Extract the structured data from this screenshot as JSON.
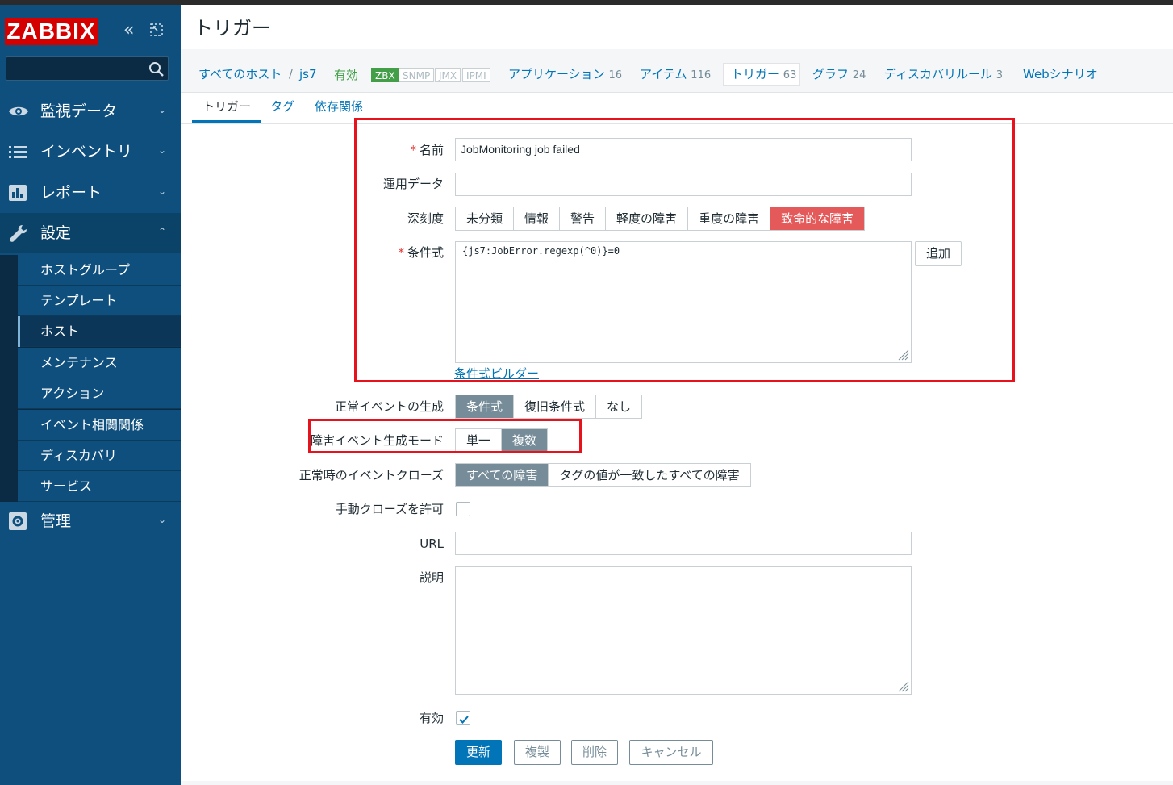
{
  "app": {
    "logo": "ZABBIX",
    "page_title": "トリガー"
  },
  "sidebar": {
    "search_placeholder": "",
    "items": [
      {
        "label": "監視データ",
        "icon": "eye-icon"
      },
      {
        "label": "インベントリ",
        "icon": "list-icon"
      },
      {
        "label": "レポート",
        "icon": "bar-chart-icon"
      },
      {
        "label": "設定",
        "icon": "wrench-icon"
      },
      {
        "label": "管理",
        "icon": "gear-icon"
      }
    ],
    "sub_items": [
      {
        "label": "ホストグループ"
      },
      {
        "label": "テンプレート"
      },
      {
        "label": "ホスト"
      },
      {
        "label": "メンテナンス"
      },
      {
        "label": "アクション"
      },
      {
        "label": "イベント相関関係"
      },
      {
        "label": "ディスカバリ"
      },
      {
        "label": "サービス"
      }
    ]
  },
  "hostbar": {
    "all_hosts": "すべてのホスト",
    "sep": "/",
    "host": "js7",
    "status": "有効",
    "badges": [
      "ZBX",
      "SNMP",
      "JMX",
      "IPMI"
    ],
    "links": [
      {
        "label": "アプリケーション",
        "count": "16"
      },
      {
        "label": "アイテム",
        "count": "116"
      },
      {
        "label": "トリガー",
        "count": "63"
      },
      {
        "label": "グラフ",
        "count": "24"
      },
      {
        "label": "ディスカバリルール",
        "count": "3"
      },
      {
        "label": "Webシナリオ",
        "count": ""
      }
    ]
  },
  "subtabs": [
    "トリガー",
    "タグ",
    "依存関係"
  ],
  "form": {
    "name_label": "名前",
    "name_value": "JobMonitoring job failed",
    "opdata_label": "運用データ",
    "opdata_value": "",
    "severity_label": "深刻度",
    "severities": [
      "未分類",
      "情報",
      "警告",
      "軽度の障害",
      "重度の障害",
      "致命的な障害"
    ],
    "severity_selected": "致命的な障害",
    "expression_label": "条件式",
    "expression_value": "{js7:JobError.regexp(^0)}=0",
    "add_button": "追加",
    "expression_builder": "条件式ビルダー",
    "ok_event_label": "正常イベントの生成",
    "ok_event_options": [
      "条件式",
      "復旧条件式",
      "なし"
    ],
    "problem_mode_label": "障害イベント生成モード",
    "problem_mode_options": [
      "単一",
      "複数"
    ],
    "ok_close_label": "正常時のイベントクローズ",
    "ok_close_options": [
      "すべての障害",
      "タグの値が一致したすべての障害"
    ],
    "manual_close_label": "手動クローズを許可",
    "manual_close_checked": false,
    "url_label": "URL",
    "url_value": "",
    "description_label": "説明",
    "description_value": "",
    "enabled_label": "有効",
    "enabled_checked": true
  },
  "buttons": {
    "update": "更新",
    "clone": "複製",
    "delete": "削除",
    "cancel": "キャンセル"
  }
}
